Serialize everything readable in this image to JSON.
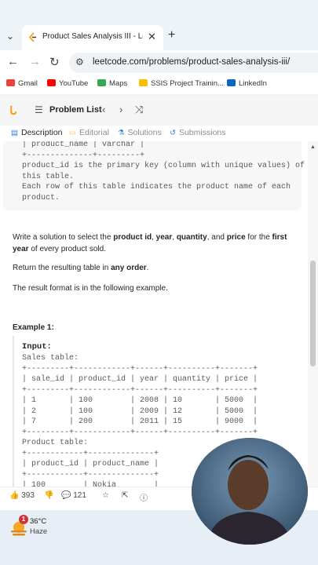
{
  "browser": {
    "tab_title": "Product Sales Analysis III - Leet",
    "url": "leetcode.com/problems/product-sales-analysis-iii/",
    "bookmarks": [
      {
        "label": "Gmail",
        "icon": "gmail-icon",
        "color": "#ea4335"
      },
      {
        "label": "YouTube",
        "icon": "youtube-icon",
        "color": "#ff0000"
      },
      {
        "label": "Maps",
        "icon": "maps-icon",
        "color": "#34a853"
      },
      {
        "label": "SSIS Project Trainin...",
        "icon": "drive-icon",
        "color": "#fbbc04"
      },
      {
        "label": "LinkedIn",
        "icon": "linkedin-icon",
        "color": "#0a66c2"
      }
    ]
  },
  "leetcode": {
    "problem_list_label": "Problem List",
    "tabs": [
      "Description",
      "Editorial",
      "Solutions",
      "Submissions"
    ]
  },
  "content": {
    "schema_tail": "| product_name | varchar |\n+--------------+---------+\nproduct_id is the primary key (column with unique values) of\nthis table.\nEach row of this table indicates the product name of each\nproduct.",
    "p1_a": "Write a solution to select the ",
    "p1_b1": "product id",
    "p1_c": ", ",
    "p1_b2": "year",
    "p1_d": ", ",
    "p1_b3": "quantity",
    "p1_e": ", and ",
    "p1_b4": "price",
    "p1_f": " for the ",
    "p1_b5": "first year",
    "p1_g": " of every product sold.",
    "p2_a": "Return the resulting table in ",
    "p2_b": "any order",
    "p2_c": ".",
    "p3": "The result format is in the following example.",
    "example_title": "Example 1:",
    "input_label": "Input:",
    "example_text": "Sales table:\n+---------+------------+------+----------+-------+\n| sale_id | product_id | year | quantity | price |\n+---------+------------+------+----------+-------+\n| 1       | 100        | 2008 | 10       | 5000  |\n| 2       | 100        | 2009 | 12       | 5000  |\n| 7       | 200        | 2011 | 15       | 9000  |\n+---------+------------+------+----------+-------+\nProduct table:\n+------------+--------------+\n| product_id | product_name |\n+------------+--------------+\n| 100        | Nokia        |"
  },
  "actions": {
    "likes": "393",
    "comments": "121"
  },
  "taskbar": {
    "badge": "1",
    "temperature": "36°C",
    "condition": "Haze"
  }
}
